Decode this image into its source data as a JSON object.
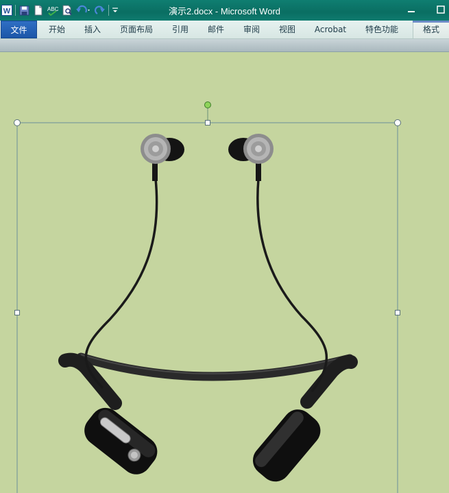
{
  "window": {
    "title": "演示2.docx  -  Microsoft Word",
    "app_icon_letter": "W"
  },
  "quick_access": {
    "items": [
      "word-app-icon",
      "save-icon",
      "new-document-icon",
      "spelling-icon",
      "print-preview-icon",
      "undo-icon",
      "redo-icon",
      "customize-toolbar-icon"
    ]
  },
  "ribbon": {
    "tabs": [
      {
        "label": "文件"
      },
      {
        "label": "开始"
      },
      {
        "label": "插入"
      },
      {
        "label": "页面布局"
      },
      {
        "label": "引用"
      },
      {
        "label": "邮件"
      },
      {
        "label": "审阅"
      },
      {
        "label": "视图"
      },
      {
        "label": "Acrobat"
      },
      {
        "label": "特色功能"
      },
      {
        "label": "格式"
      }
    ]
  },
  "document": {
    "selected_object": "earphone-image",
    "background_color": "#c5d59f"
  }
}
